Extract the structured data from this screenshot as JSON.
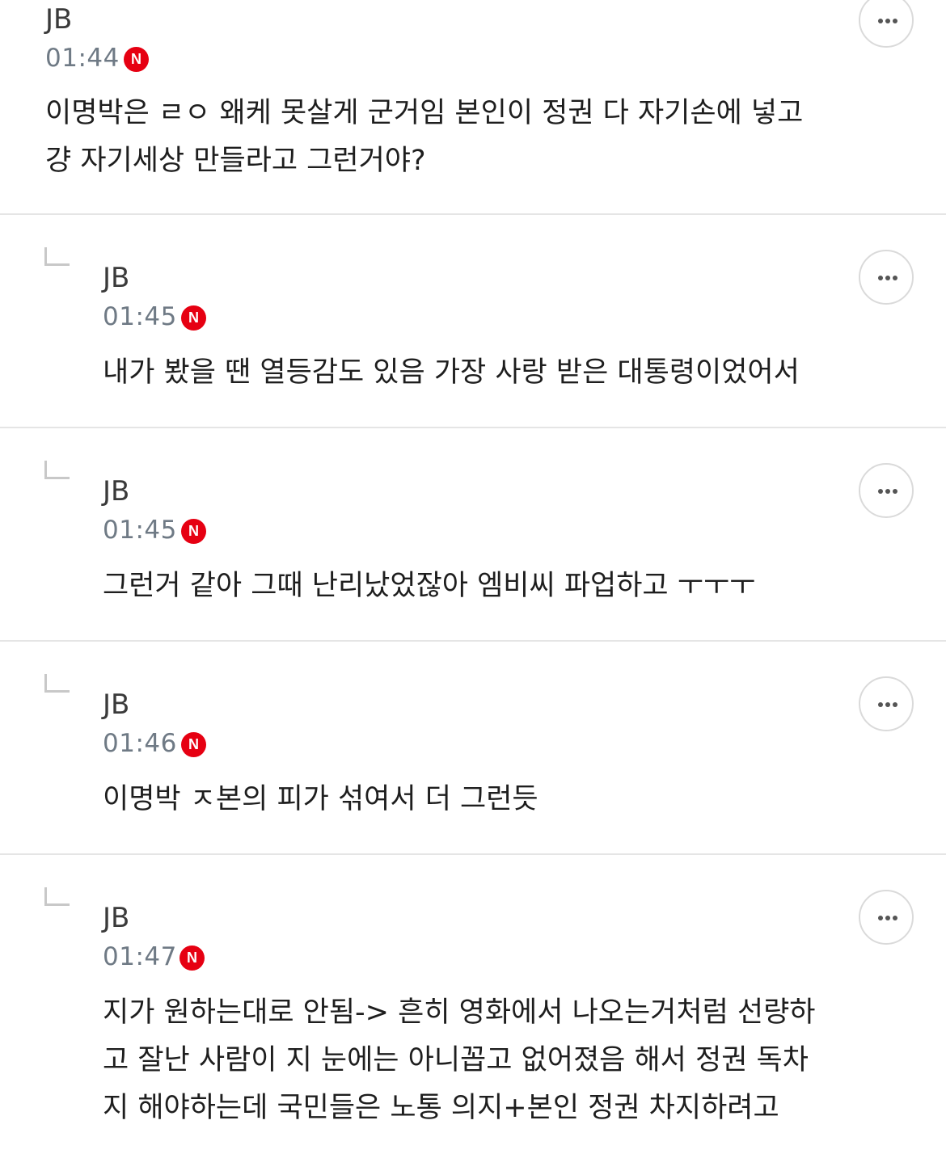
{
  "comments": [
    {
      "author": "JB",
      "time": "01:44",
      "badge": "N",
      "text": "이명박은 ㄹㅇ 왜케 못살게 군거임 본인이 정권 다 자기손에 넣고\n걍 자기세상 만들라고 그런거야?",
      "is_reply": false
    },
    {
      "author": "JB",
      "time": "01:45",
      "badge": "N",
      "text": "내가 봤을 땐 열등감도 있음 가장 사랑 받은 대통령이었어서",
      "is_reply": true
    },
    {
      "author": "JB",
      "time": "01:45",
      "badge": "N",
      "text": "그런거 같아 그때 난리났었잖아 엠비씨 파업하고 ㅜㅜㅜ",
      "is_reply": true
    },
    {
      "author": "JB",
      "time": "01:46",
      "badge": "N",
      "text": "이명박 ㅈ본의 피가 섞여서 더 그런듯",
      "is_reply": true
    },
    {
      "author": "JB",
      "time": "01:47",
      "badge": "N",
      "text": "지가 원하는대로 안됨-> 흔히 영화에서 나오는거처럼 선량하\n고 잘난 사람이 지 눈에는 아니꼽고 없어졌음 해서 정권 독차\n지 해야하는데 국민들은 노통 의지+본인 정권 차지하려고",
      "is_reply": true
    }
  ],
  "icons": {
    "more": "more-horizontal-icon",
    "reply": "reply-arrow-icon",
    "new_badge": "new-badge-icon"
  },
  "colors": {
    "new_badge": "#e60012",
    "timestamp": "#6f7a85",
    "divider": "#e5e5e5"
  }
}
